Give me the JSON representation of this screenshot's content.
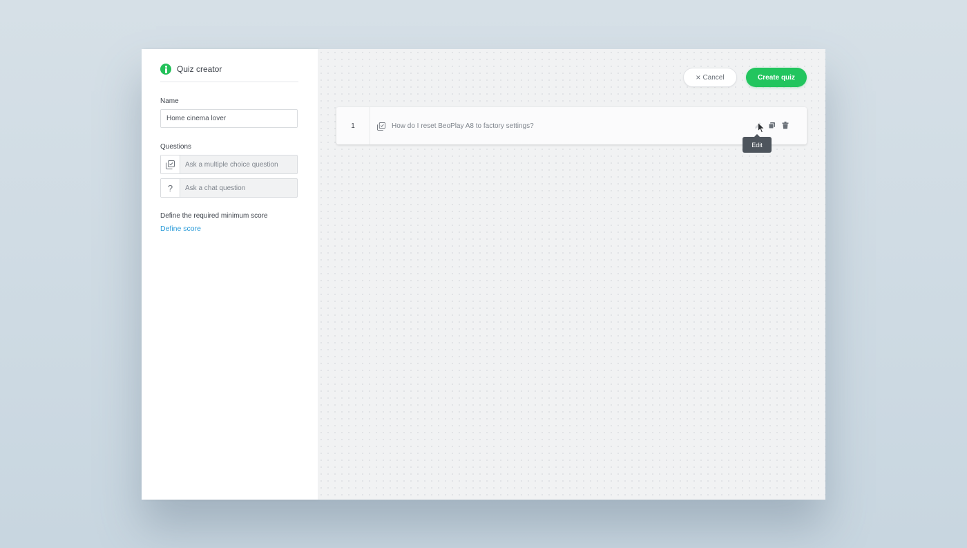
{
  "app": {
    "title": "Quiz creator",
    "brand_color": "#24c15a",
    "icon": "info-logo-icon"
  },
  "sidebar": {
    "name_label": "Name",
    "name_value": "Home cinema lover",
    "questions_label": "Questions",
    "question_types": [
      {
        "label": "Ask a multiple choice question",
        "icon": "checkbox-stack-icon"
      },
      {
        "label": "Ask a chat question",
        "icon": "question-mark-icon",
        "glyph": "?"
      }
    ],
    "score_label": "Define the required minimum score",
    "score_link": "Define score",
    "link_color": "#2a9bd8"
  },
  "toolbar": {
    "cancel_icon": "×",
    "cancel_label": "Cancel",
    "create_label": "Create quiz",
    "create_color": "#22c55e"
  },
  "questions": [
    {
      "number": "1",
      "type_icon": "checkbox-stack-icon",
      "text": "How do I reset BeoPlay A8 to factory settings?"
    }
  ],
  "row_actions": {
    "icons": [
      "edit-icon",
      "duplicate-icon",
      "delete-icon"
    ],
    "tooltip": "Edit"
  }
}
